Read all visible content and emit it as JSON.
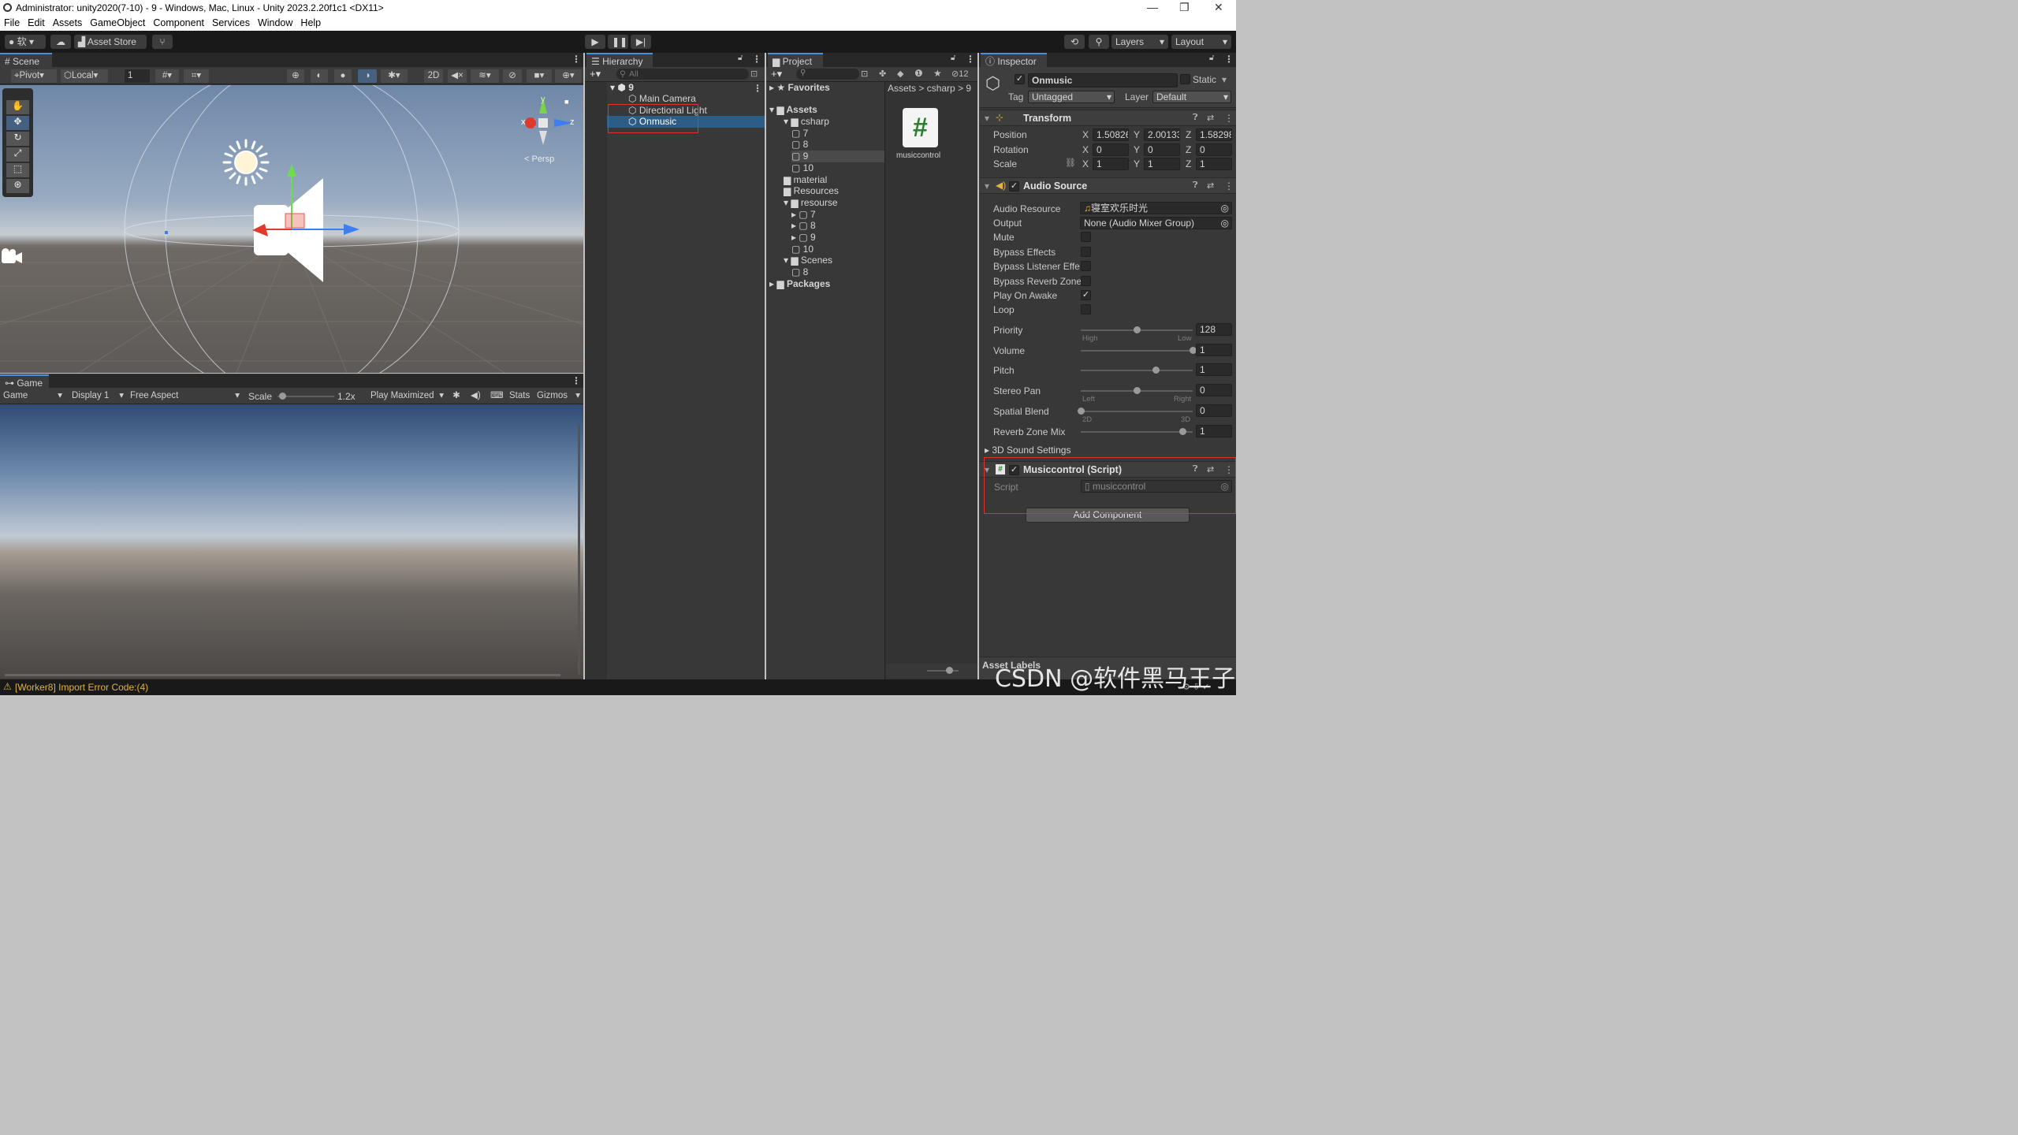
{
  "window": {
    "title": "Administrator: unity2020(7-10) - 9 - Windows, Mac, Linux - Unity 2023.2.20f1c1 <DX11>",
    "controls": {
      "minimize": "—",
      "maximize": "❐",
      "close": "✕"
    }
  },
  "menu": [
    "File",
    "Edit",
    "Assets",
    "GameObject",
    "Component",
    "Services",
    "Window",
    "Help"
  ],
  "toolbar": {
    "account": "软",
    "asset_store": "Asset Store",
    "layers": "Layers",
    "layout": "Layout"
  },
  "scene": {
    "tab": "Scene",
    "pivot": "Pivot",
    "local": "Local",
    "grid_value": "1",
    "mode_2d": "2D",
    "persp_label": "< Persp",
    "gizmo_axes": {
      "x": "x",
      "y": "y",
      "z": "z"
    }
  },
  "game": {
    "tab": "Game",
    "mode": "Game",
    "display": "Display 1",
    "aspect": "Free Aspect",
    "scale_label": "Scale",
    "scale_value": "1.2x",
    "scale_level": 0.08,
    "play_mode": "Play Maximized",
    "stats": "Stats",
    "gizmos": "Gizmos"
  },
  "hierarchy": {
    "tab": "Hierarchy",
    "search_placeholder": "All",
    "scene_name": "9",
    "items": [
      "Main Camera",
      "Directional Light",
      "Onmusic"
    ],
    "selected": "Onmusic"
  },
  "project": {
    "tab": "Project",
    "favorites": "Favorites",
    "assets": "Assets",
    "tree": [
      {
        "name": "csharp",
        "indent": 1
      },
      {
        "name": "7",
        "indent": 2
      },
      {
        "name": "8",
        "indent": 2
      },
      {
        "name": "9",
        "indent": 2
      },
      {
        "name": "10",
        "indent": 2
      },
      {
        "name": "material",
        "indent": 1
      },
      {
        "name": "Resources",
        "indent": 1
      },
      {
        "name": "resourse",
        "indent": 1
      },
      {
        "name": "7",
        "indent": 2
      },
      {
        "name": "8",
        "indent": 2
      },
      {
        "name": "9",
        "indent": 2
      },
      {
        "name": "10",
        "indent": 2
      },
      {
        "name": "Scenes",
        "indent": 1
      },
      {
        "name": "8",
        "indent": 2
      }
    ],
    "packages": "Packages",
    "breadcrumb": [
      "Assets",
      "csharp",
      "9"
    ],
    "hidden_count": "12",
    "file": {
      "name": "musiccontrol",
      "icon_glyph": "#"
    }
  },
  "inspector": {
    "tab": "Inspector",
    "object_name": "Onmusic",
    "static_label": "Static",
    "tag_label": "Tag",
    "tag_value": "Untagged",
    "layer_label": "Layer",
    "layer_value": "Default",
    "transform": {
      "title": "Transform",
      "position_label": "Position",
      "rotation_label": "Rotation",
      "scale_label": "Scale",
      "position": {
        "x": "1.50826",
        "y": "2.00133",
        "z": "1.58298"
      },
      "rotation": {
        "x": "0",
        "y": "0",
        "z": "0"
      },
      "scale": {
        "x": "1",
        "y": "1",
        "z": "1"
      },
      "axis_x": "X",
      "axis_y": "Y",
      "axis_z": "Z"
    },
    "audio_source": {
      "title": "Audio Source",
      "audio_resource_label": "Audio Resource",
      "audio_resource_value": "寝室欢乐时光",
      "output_label": "Output",
      "output_value": "None (Audio Mixer Group)",
      "mute_label": "Mute",
      "mute": false,
      "bypass_effects_label": "Bypass Effects",
      "bypass_effects": false,
      "bypass_listener_label": "Bypass Listener Effe",
      "bypass_listener": false,
      "bypass_reverb_label": "Bypass Reverb Zone",
      "bypass_reverb": false,
      "play_on_awake_label": "Play On Awake",
      "play_on_awake": true,
      "loop_label": "Loop",
      "loop": false,
      "priority_label": "Priority",
      "priority_value": "128",
      "priority_pos": 0.5,
      "priority_min": "High",
      "priority_max": "Low",
      "volume_label": "Volume",
      "volume_value": "1",
      "volume_pos": 1.0,
      "pitch_label": "Pitch",
      "pitch_value": "1",
      "pitch_pos": 0.67,
      "stereo_label": "Stereo Pan",
      "stereo_value": "0",
      "stereo_pos": 0.5,
      "stereo_min": "Left",
      "stereo_max": "Right",
      "spatial_label": "Spatial Blend",
      "spatial_value": "0",
      "spatial_pos": 0.0,
      "spatial_min": "2D",
      "spatial_max": "3D",
      "reverb_label": "Reverb Zone Mix",
      "reverb_value": "1",
      "reverb_pos": 0.91,
      "sound3d_label": "3D Sound Settings"
    },
    "script_component": {
      "title": "Musiccontrol (Script)",
      "script_label": "Script",
      "script_value": "musiccontrol"
    },
    "add_component": "Add Component",
    "asset_labels": "Asset Labels"
  },
  "status": {
    "message": "[Worker8] Import Error Code:(4)"
  },
  "watermark": "CSDN @软件黑马王子",
  "colors": {
    "accent_blue": "#2c5d87",
    "annotation_red": "#e0312c",
    "warning_yellow": "#e3b341",
    "script_green": "#2e7d32"
  }
}
